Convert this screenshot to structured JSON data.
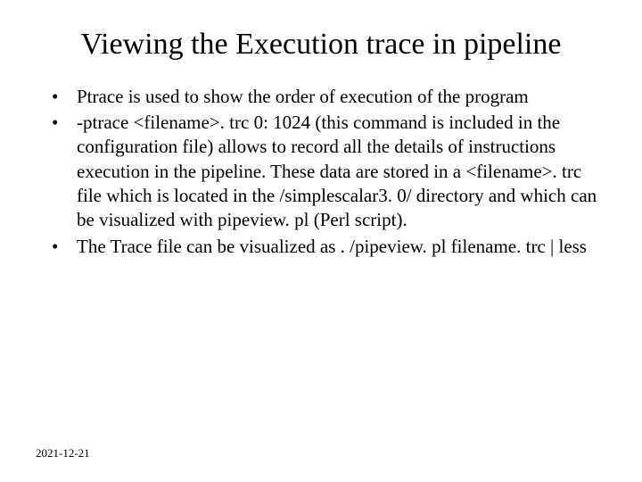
{
  "title": "Viewing the Execution trace in pipeline",
  "bullets": [
    "Ptrace is used to show the order of execution of the program",
    "-ptrace <filename>. trc 0: 1024 (this command is included in the configuration file) allows to record all the details of instructions execution in the pipeline. These data are stored in a  <filename>. trc file which is located in the /simplescalar3. 0/ directory and which can be visualized with pipeview. pl (Perl script).",
    "The Trace file can be visualized as . /pipeview. pl filename. trc | less"
  ],
  "footer": "2021-12-21"
}
